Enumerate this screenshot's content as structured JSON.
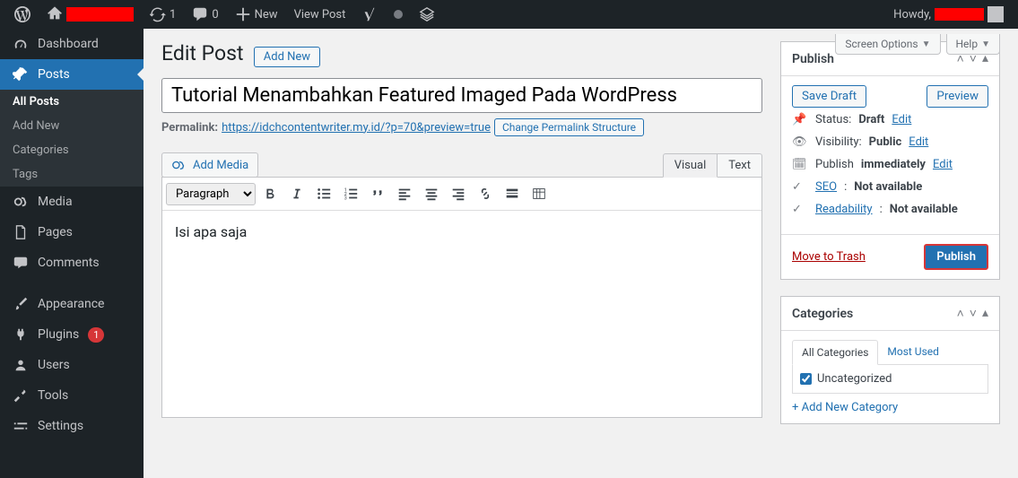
{
  "adminbar": {
    "updates_count": "1",
    "comments_count": "0",
    "new_label": "New",
    "view_post_label": "View Post",
    "howdy_prefix": "Howdy,"
  },
  "sidebar": {
    "items": [
      {
        "icon": "dashboard",
        "label": "Dashboard",
        "active": false
      },
      {
        "icon": "pin",
        "label": "Posts",
        "active": true
      },
      {
        "icon": "media",
        "label": "Media",
        "active": false
      },
      {
        "icon": "page",
        "label": "Pages",
        "active": false
      },
      {
        "icon": "comments",
        "label": "Comments",
        "active": false
      },
      {
        "sep": true
      },
      {
        "icon": "appearance",
        "label": "Appearance",
        "active": false
      },
      {
        "icon": "plugins",
        "label": "Plugins",
        "active": false,
        "badge": "1"
      },
      {
        "icon": "users",
        "label": "Users",
        "active": false
      },
      {
        "icon": "tools",
        "label": "Tools",
        "active": false
      },
      {
        "icon": "settings",
        "label": "Settings",
        "active": false
      }
    ],
    "posts_submenu": [
      "All Posts",
      "Add New",
      "Categories",
      "Tags"
    ],
    "posts_submenu_current": 0
  },
  "screen_meta": {
    "screen_options_label": "Screen Options",
    "help_label": "Help"
  },
  "page": {
    "title": "Edit Post",
    "add_new_label": "Add New"
  },
  "post": {
    "title_value": "Tutorial Menambahkan Featured Imaged Pada WordPress",
    "permalink_label": "Permalink:",
    "permalink_url": "https://idchcontentwriter.my.id/?p=70&preview=true",
    "change_permalink_label": "Change Permalink Structure",
    "add_media_label": "Add Media",
    "editor_tabs": [
      "Visual",
      "Text"
    ],
    "active_tab": 0,
    "format_select": "Paragraph",
    "body_text": "Isi apa saja"
  },
  "publish_box": {
    "title": "Publish",
    "save_draft_label": "Save Draft",
    "preview_label": "Preview",
    "status_label": "Status:",
    "status_value": "Draft",
    "edit_label": "Edit",
    "visibility_label": "Visibility:",
    "visibility_value": "Public",
    "publish_label": "Publish",
    "immediately_label": "immediately",
    "seo_label": "SEO",
    "seo_value": "Not available",
    "readability_label": "Readability",
    "readability_value": "Not available",
    "trash_label": "Move to Trash",
    "publish_btn_label": "Publish"
  },
  "categories_box": {
    "title": "Categories",
    "tabs": [
      "All Categories",
      "Most Used"
    ],
    "active_tab": 0,
    "items": [
      {
        "label": "Uncategorized",
        "checked": true
      }
    ],
    "add_new_label": "+ Add New Category"
  }
}
